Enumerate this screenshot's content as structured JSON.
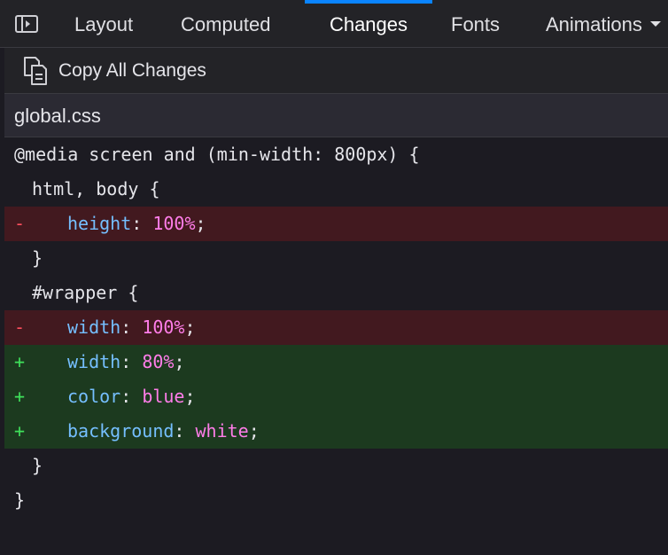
{
  "tabs": {
    "layout": "Layout",
    "computed": "Computed",
    "changes": "Changes",
    "fonts": "Fonts",
    "animations": "Animations"
  },
  "toolbar": {
    "copy_all_label": "Copy All Changes"
  },
  "file": {
    "name": "global.css"
  },
  "code": {
    "media_rule": "@media screen and (min-width: 800px) {",
    "selector1": "html, body {",
    "selector2": "#wrapper {",
    "close": "}",
    "removed_marker": "-",
    "added_marker": "+",
    "decls": [
      {
        "prop": "height",
        "value": "100%",
        "status": "removed"
      },
      {
        "prop": "width",
        "value": "100%",
        "status": "removed"
      },
      {
        "prop": "width",
        "value": "80%",
        "status": "added"
      },
      {
        "prop": "color",
        "value": "blue",
        "status": "added"
      },
      {
        "prop": "background",
        "value": "white",
        "status": "added"
      }
    ]
  },
  "colors": {
    "accent": "#0a84ff",
    "removed_bg": "#42191f",
    "added_bg": "#1c3a1f",
    "property": "#75bfff",
    "value": "#ff7de9"
  },
  "icons": {
    "sidebar_toggle": "sidebar-toggle-icon",
    "copy": "copy-icon",
    "overflow": "chevron-down-icon"
  }
}
